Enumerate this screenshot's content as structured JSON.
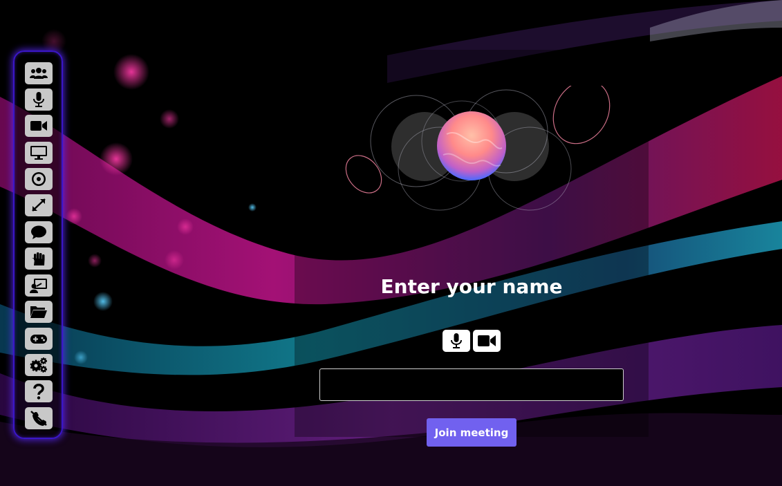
{
  "theme": {
    "accent": "#7161ef",
    "sidebar_glow": "#3a16c8",
    "button_gray": "#c8c8c8"
  },
  "sidebar": {
    "buttons": [
      {
        "icon": "users-icon"
      },
      {
        "icon": "microphone-icon"
      },
      {
        "icon": "video-camera-icon"
      },
      {
        "icon": "screen-share-icon"
      },
      {
        "icon": "record-icon"
      },
      {
        "icon": "fullscreen-icon"
      },
      {
        "icon": "chat-icon"
      },
      {
        "icon": "raise-hand-icon"
      },
      {
        "icon": "whiteboard-icon"
      },
      {
        "icon": "folder-open-icon"
      },
      {
        "icon": "gamepad-icon"
      },
      {
        "icon": "settings-icon"
      },
      {
        "icon": "help-icon"
      },
      {
        "icon": "leave-call-icon"
      }
    ]
  },
  "join_dialog": {
    "title": "Enter your name",
    "mic_icon": "microphone-icon",
    "camera_icon": "video-camera-icon",
    "name_value": "",
    "join_label": "Join meeting"
  }
}
